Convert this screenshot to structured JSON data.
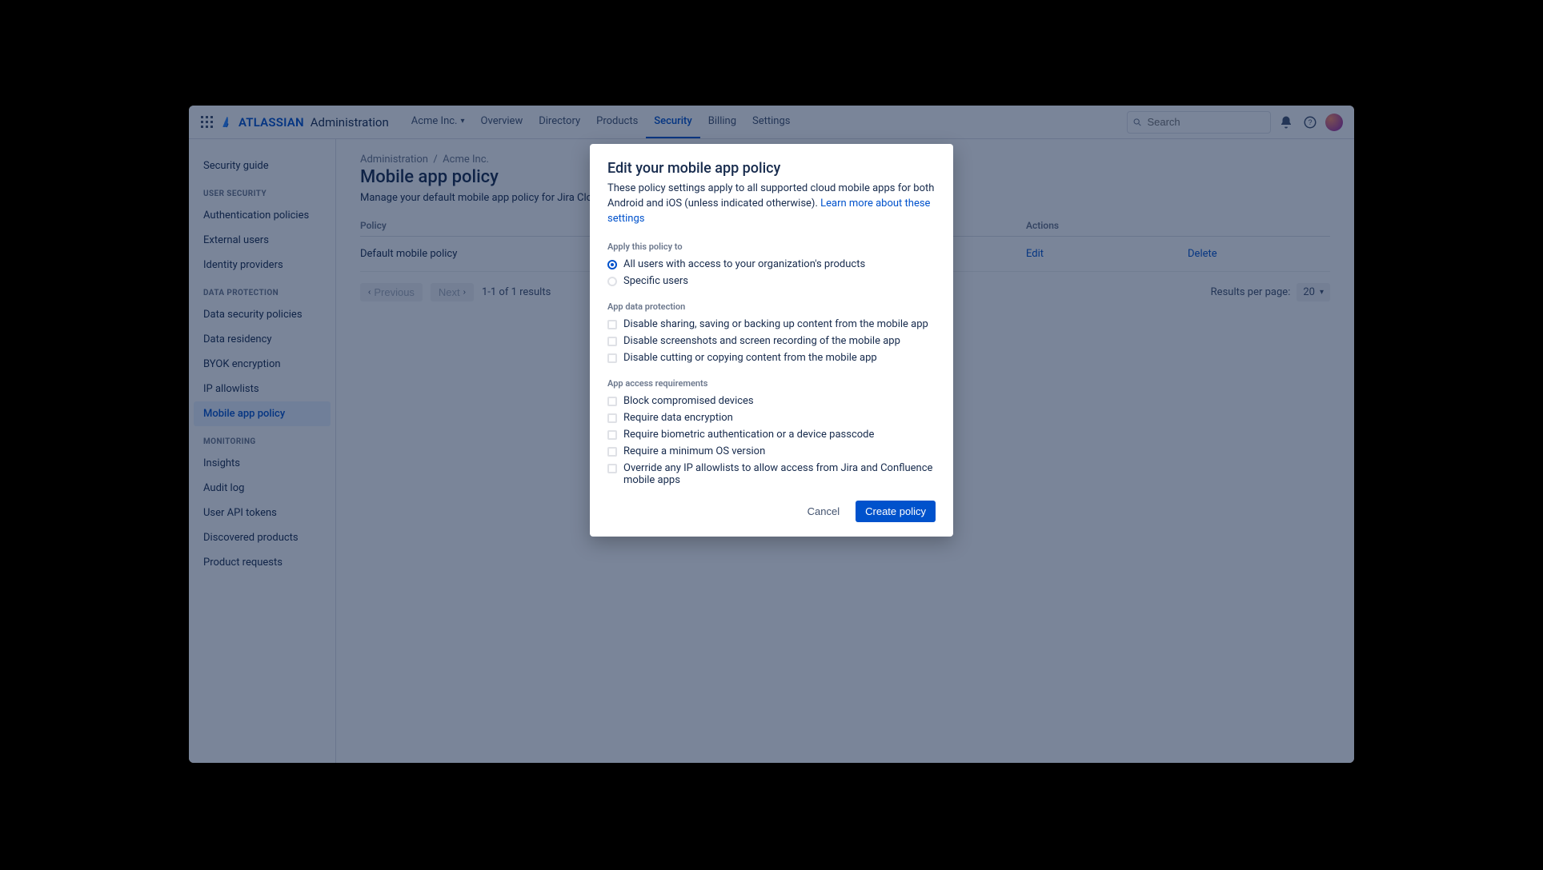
{
  "header": {
    "brand": "ATLASSIAN",
    "brand_sub": "Administration",
    "org_name": "Acme Inc.",
    "nav": [
      "Overview",
      "Directory",
      "Products",
      "Security",
      "Billing",
      "Settings"
    ],
    "active_nav": "Security",
    "search_placeholder": "Search"
  },
  "sidebar": {
    "top_link": "Security guide",
    "groups": [
      {
        "title": "USER SECURITY",
        "items": [
          "Authentication policies",
          "External users",
          "Identity providers"
        ]
      },
      {
        "title": "DATA PROTECTION",
        "items": [
          "Data security policies",
          "Data residency",
          "BYOK encryption",
          "IP allowlists",
          "Mobile app policy"
        ]
      },
      {
        "title": "MONITORING",
        "items": [
          "Insights",
          "Audit log",
          "User API tokens",
          "Discovered products",
          "Product requests"
        ]
      }
    ],
    "active_item": "Mobile app policy"
  },
  "page": {
    "crumb1": "Administration",
    "crumb2": "Acme Inc.",
    "title": "Mobile app policy",
    "description": "Manage your default mobile app policy for Jira Cloud, Confluence Cloud and Opsgenie mobile apps.",
    "table_headers": {
      "policy": "Policy",
      "actions": "Actions"
    },
    "rows": [
      {
        "name": "Default mobile policy",
        "edit": "Edit",
        "delete": "Delete"
      }
    ],
    "prev": "Previous",
    "next": "Next",
    "count": "1-1 of 1 results",
    "rpp_label": "Results per page:",
    "rpp_value": "20"
  },
  "modal": {
    "title": "Edit your mobile app policy",
    "intro_text": "These policy settings apply to all supported cloud mobile apps for both Android and iOS (unless indicated otherwise). ",
    "intro_link": "Learn more about these settings",
    "apply_label": "Apply this policy to",
    "apply_options": [
      "All users with access to your organization's products",
      "Specific users"
    ],
    "protection_label": "App data protection",
    "protection_options": [
      "Disable sharing, saving or backing up content from the mobile app",
      "Disable screenshots and screen recording of the mobile app",
      "Disable cutting or copying content from the mobile app"
    ],
    "access_label": "App access requirements",
    "access_options": [
      "Block compromised devices",
      "Require data encryption",
      "Require biometric authentication or a device passcode",
      "Require a minimum OS version",
      "Override any IP allowlists to allow access from Jira and Confluence mobile apps"
    ],
    "cancel": "Cancel",
    "submit": "Create policy"
  }
}
